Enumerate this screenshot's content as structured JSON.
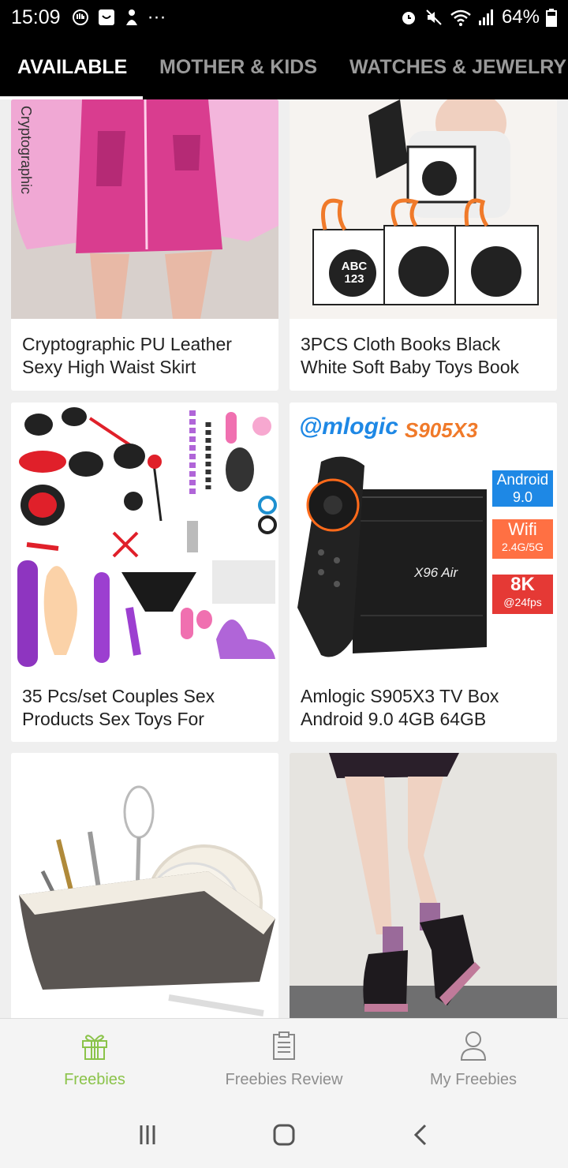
{
  "status_bar": {
    "time": "15:09",
    "more": "···",
    "battery": "64%",
    "left_icons": [
      "hand-icon",
      "chat-icon",
      "person-icon"
    ],
    "right_icons": [
      "alarm-icon",
      "mute-icon",
      "wifi-icon",
      "signal-icon",
      "battery-icon"
    ]
  },
  "tabs": [
    {
      "label": "AVAILABLE",
      "active": true
    },
    {
      "label": "MOTHER & KIDS",
      "active": false
    },
    {
      "label": "WATCHES & JEWELRY",
      "active": false
    }
  ],
  "products": [
    {
      "title": "Cryptographic PU Leather Sexy High Waist Skirt",
      "image_text": "Cryptographic"
    },
    {
      "title": "3PCS Cloth Books Black White Soft Baby Toys Book",
      "image_text": "ABC 123"
    },
    {
      "title": "35 Pcs/set Couples Sex Products Sex Toys For"
    },
    {
      "title": "Amlogic S905X3 TV Box Android 9.0 4GB 64GB",
      "brand": "@mlogic",
      "model": "S905X3",
      "device": "X96 Air",
      "badges": [
        {
          "line1": "Android",
          "line2": "9.0",
          "color": "#1e88e5"
        },
        {
          "line1": "Wifi",
          "line2": "2.4G/5G",
          "color": "#ff7043"
        },
        {
          "line1": "8K",
          "line2": "@24fps",
          "color": "#e53935"
        }
      ]
    },
    {
      "title": ""
    },
    {
      "title": ""
    }
  ],
  "bottom_nav": [
    {
      "label": "Freebies",
      "icon": "gift-icon",
      "active": true
    },
    {
      "label": "Freebies Review",
      "icon": "clipboard-icon",
      "active": false
    },
    {
      "label": "My Freebies",
      "icon": "user-icon",
      "active": false
    }
  ],
  "colors": {
    "accent": "#8bc34a",
    "tabbar": "#000000",
    "background": "#efefef"
  }
}
